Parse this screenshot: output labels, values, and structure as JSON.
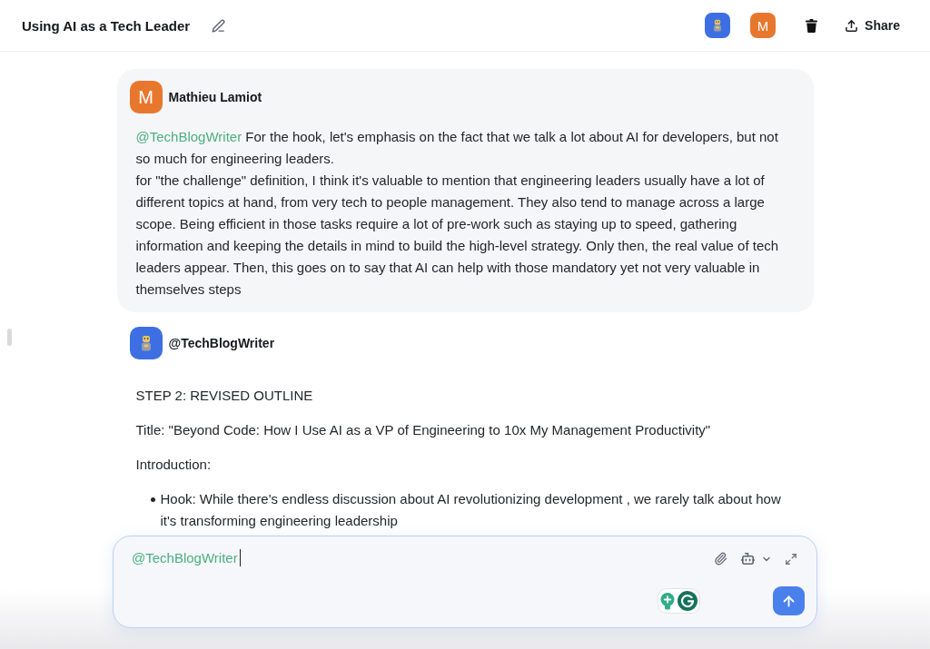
{
  "header": {
    "title": "Using AI as a Tech Leader",
    "participants": [
      {
        "kind": "bot"
      },
      {
        "kind": "user",
        "initial": "M"
      }
    ],
    "share_label": "Share"
  },
  "messages": [
    {
      "kind": "user",
      "author": "Mathieu Lamiot",
      "avatar_initial": "M",
      "mention": "@TechBlogWriter",
      "paragraphs": [
        "For the hook, let's emphasis on the fact that we talk a lot about AI for developers, but not so much for engineering leaders.",
        "for \"the challenge\" definition, I think it's valuable to mention that engineering leaders usually have a lot of different topics at hand, from very tech to people management. They also tend to manage across a large scope. Being efficient in those tasks require a lot of pre-work such as staying up to speed, gathering information and keeping the details in mind to build the high-level strategy. Only then, the real value of tech leaders appear. Then, this goes on to say that AI can help with those mandatory yet not very valuable in themselves steps"
      ]
    },
    {
      "kind": "bot",
      "author": "@TechBlogWriter",
      "blocks": [
        {
          "kind": "paragraph",
          "text": "STEP 2: REVISED OUTLINE"
        },
        {
          "kind": "paragraph",
          "text": "Title: \"Beyond Code: How I Use AI as a VP of Engineering to 10x My Management Productivity\""
        },
        {
          "kind": "paragraph",
          "text": "Introduction:"
        },
        {
          "kind": "bullets",
          "items": [
            "Hook: While there's endless discussion about AI revolutionizing development , we rarely talk about how it's transforming engineering leadership"
          ]
        }
      ]
    }
  ],
  "composer": {
    "value": "@TechBlogWriter"
  }
}
